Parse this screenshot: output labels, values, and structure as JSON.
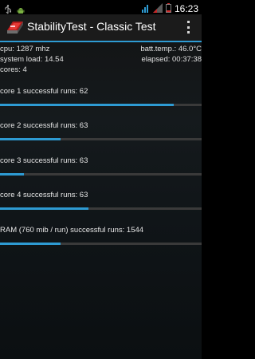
{
  "status_bar": {
    "time": "16:23",
    "icons": [
      "usb-icon",
      "android-icon",
      "signal-icon",
      "battery-icon"
    ]
  },
  "app": {
    "title": "StabilityTest - Classic Test",
    "accent": "#2e9bd3"
  },
  "info": {
    "cpu": "cpu: 1287 mhz",
    "batt_temp": "batt.temp.: 46.0°C",
    "system_load": "system load: 14.54",
    "elapsed": "elapsed: 00:37:38",
    "cores": "cores: 4"
  },
  "rows": [
    {
      "label": "core 1 successful runs: 62",
      "progress": 0.86
    },
    {
      "label": "core 2 successful runs: 63",
      "progress": 0.3
    },
    {
      "label": "core 3 successful runs: 63",
      "progress": 0.12
    },
    {
      "label": "core 4 successful runs: 63",
      "progress": 0.44
    },
    {
      "label": "RAM (760 mib / run) successful runs: 1544",
      "progress": 0.3
    }
  ]
}
